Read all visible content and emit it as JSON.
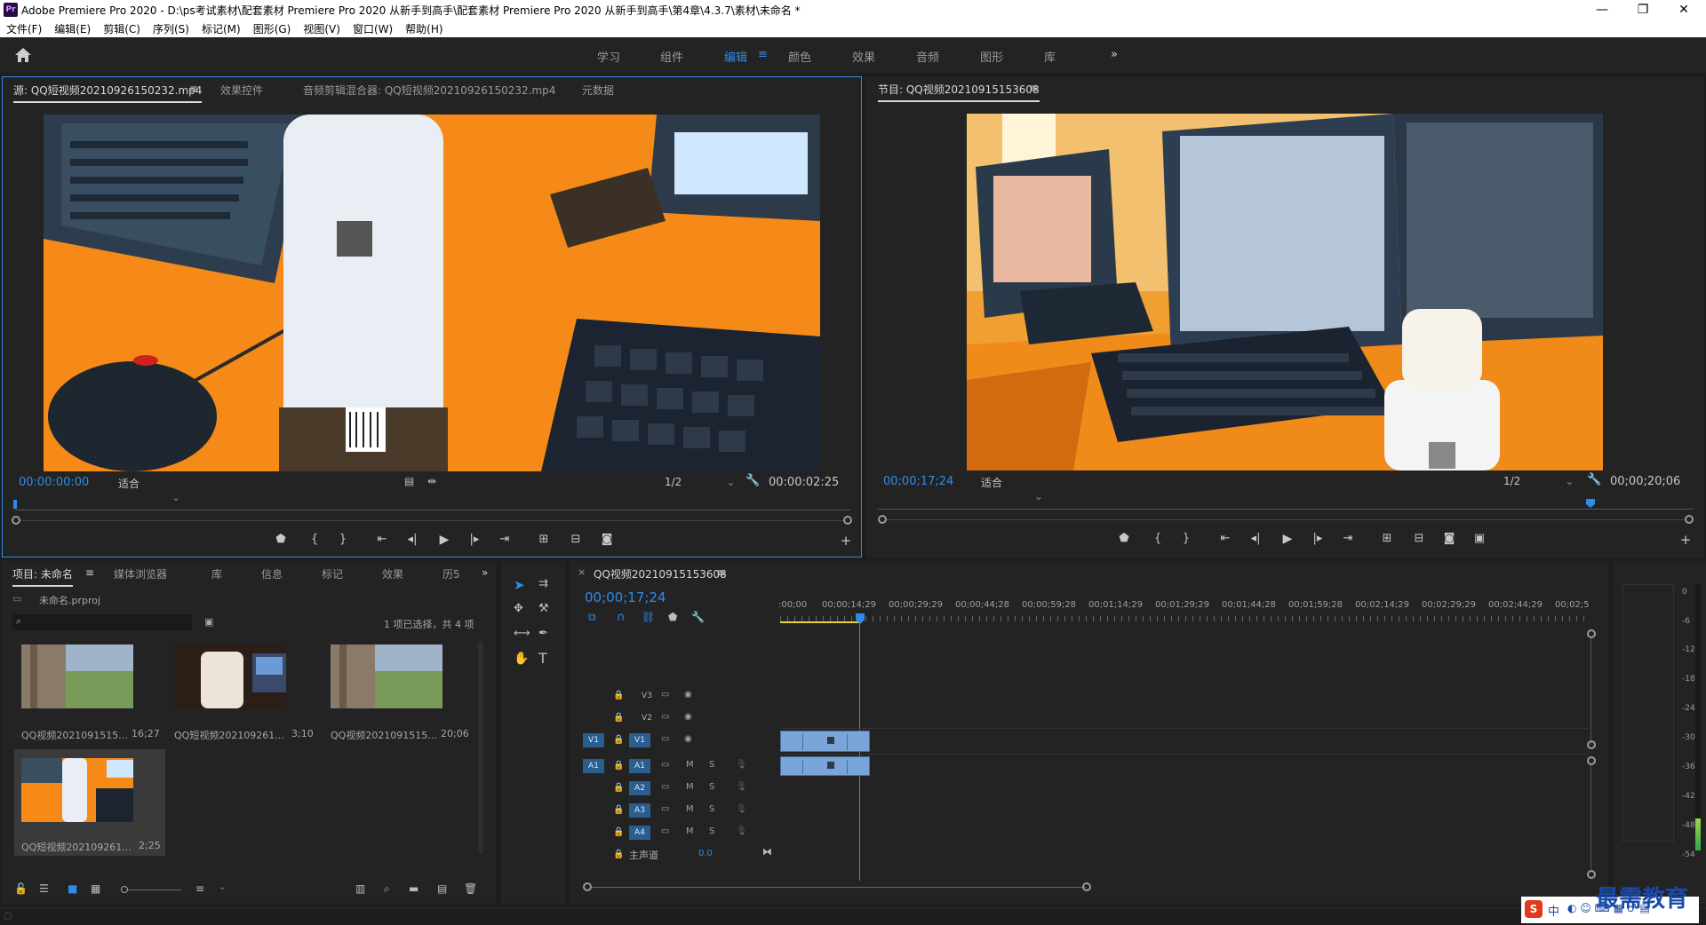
{
  "titlebar": {
    "app_icon": "Pr",
    "title": "Adobe Premiere Pro 2020 - D:\\ps考试素材\\配套素材 Premiere Pro 2020 从新手到高手\\配套素材 Premiere Pro 2020 从新手到高手\\第4章\\4.3.7\\素材\\未命名 *",
    "minimize": "—",
    "maximize": "❐",
    "close": "✕"
  },
  "menu": [
    "文件(F)",
    "编辑(E)",
    "剪辑(C)",
    "序列(S)",
    "标记(M)",
    "图形(G)",
    "视图(V)",
    "窗口(W)",
    "帮助(H)"
  ],
  "workspaces": {
    "tabs": [
      "学习",
      "组件",
      "编辑",
      "颜色",
      "效果",
      "音频",
      "图形",
      "库"
    ],
    "active": "编辑",
    "menu_icon": "≡",
    "more": "»"
  },
  "source_panel": {
    "tabs": [
      "源: QQ短视频20210926150232.mp4",
      "效果控件",
      "音频剪辑混合器: QQ短视频20210926150232.mp4",
      "元数据"
    ],
    "tab_menu": "≡",
    "timecode": "00:00:00:00",
    "fit": "适合",
    "resolution": "1/2",
    "duration": "00:00:02:25"
  },
  "program_panel": {
    "tab": "节目: QQ视频20210915153608",
    "tab_menu": "≡",
    "timecode": "00;00;17;24",
    "fit": "适合",
    "resolution": "1/2",
    "duration": "00;00;20;06"
  },
  "project_panel": {
    "tabs": [
      "项目: 未命名",
      "媒体浏览器",
      "库",
      "信息",
      "标记",
      "效果",
      "历5"
    ],
    "tab_menu": "≡",
    "more": "»",
    "project_file": "未命名.prproj",
    "search_placeholder": "",
    "selection_info": "1 项已选择，共 4 项",
    "items": [
      {
        "name": "QQ视频2021091515...",
        "duration": "16;27"
      },
      {
        "name": "QQ短视频202109261...",
        "duration": "3;10"
      },
      {
        "name": "QQ视频2021091515...",
        "duration": "20;06"
      },
      {
        "name": "QQ短视频202109261...",
        "duration": "2;25"
      }
    ]
  },
  "timeline": {
    "tab": "QQ视频20210915153608",
    "tab_close": "×",
    "tab_menu": "≡",
    "timecode": "00;00;17;24",
    "ruler": [
      ":00;00",
      "00;00;14;29",
      "00;00;29;29",
      "00;00;44;28",
      "00;00;59;28",
      "00;01;14;29",
      "00;01;29;29",
      "00;01;44;28",
      "00;01;59;28",
      "00;02;14;29",
      "00;02;29;29",
      "00;02;44;29",
      "00;02;5"
    ],
    "video_tracks": [
      "V3",
      "V2",
      "V1"
    ],
    "audio_tracks": [
      "A1",
      "A2",
      "A3",
      "A4"
    ],
    "source_v": "V1",
    "source_a": "A1",
    "mute": "M",
    "solo": "S",
    "master_label": "主声道",
    "master_value": "0.0"
  },
  "meter": {
    "labels": [
      "0",
      "-6",
      "-12",
      "-18",
      "-24",
      "-30",
      "-36",
      "-42",
      "-48",
      "-54"
    ],
    "level": 0.12
  },
  "watermark": "最需教育",
  "ime": "中",
  "colors": {
    "accent": "#2d8ceb",
    "clip_video": "#7aa5d8",
    "play_line_yellow": "#e6d23a"
  }
}
